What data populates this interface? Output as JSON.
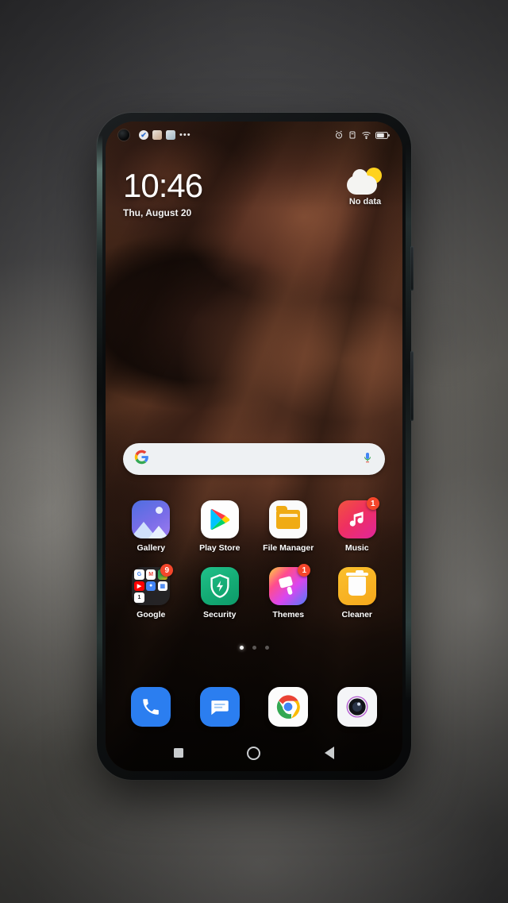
{
  "device": {
    "type": "smartphone",
    "orientation": "portrait",
    "screen_state": "home-screen"
  },
  "backdrop": {
    "description": "blurred gray studio background",
    "colors": {
      "dark": "#3b3b3e",
      "mid": "#6e6d6a",
      "light": "#8c8a85"
    }
  },
  "wallpaper": {
    "description": "aerial mars-like rocky terrain",
    "colors": {
      "rust": "#8a5337",
      "brown": "#53301f",
      "dark": "#0a0605"
    }
  },
  "status_bar": {
    "left_icons": [
      {
        "name": "punch-hole-camera",
        "glyph": ""
      },
      {
        "name": "notification-check-icon",
        "glyph": "✔"
      },
      {
        "name": "notification-app-icon-1",
        "glyph": ""
      },
      {
        "name": "notification-app-icon-2",
        "glyph": ""
      },
      {
        "name": "notification-overflow-icon",
        "glyph": "•••"
      }
    ],
    "right_icons": [
      {
        "name": "alarm-icon",
        "glyph": "⏰"
      },
      {
        "name": "vibrate-icon",
        "glyph": "▣"
      },
      {
        "name": "wifi-icon",
        "glyph": "▲"
      },
      {
        "name": "battery-icon",
        "glyph": "▭"
      }
    ]
  },
  "clock_widget": {
    "time": "10:46",
    "date": "Thu, August 20"
  },
  "weather_widget": {
    "icon": "sun-behind-cloud-icon",
    "status": "No data"
  },
  "search_bar": {
    "value": "",
    "placeholder": "",
    "left_icon": "google-g-icon",
    "right_icon": "microphone-icon"
  },
  "app_rows": [
    {
      "row": 1,
      "apps": [
        {
          "label": "Gallery",
          "icon": "gallery-icon",
          "badge": ""
        },
        {
          "label": "Play Store",
          "icon": "play-store-icon",
          "badge": ""
        },
        {
          "label": "File Manager",
          "icon": "file-manager-icon",
          "badge": ""
        },
        {
          "label": "Music",
          "icon": "music-icon",
          "badge": "1"
        }
      ]
    },
    {
      "row": 2,
      "apps": [
        {
          "label": "Google",
          "icon": "google-folder-icon",
          "badge": "9"
        },
        {
          "label": "Security",
          "icon": "security-icon",
          "badge": ""
        },
        {
          "label": "Themes",
          "icon": "themes-icon",
          "badge": "1"
        },
        {
          "label": "Cleaner",
          "icon": "cleaner-icon",
          "badge": ""
        }
      ]
    }
  ],
  "google_folder_contents": [
    {
      "name": "google-search-icon",
      "glyph": "G",
      "color": "#4285f4"
    },
    {
      "name": "gmail-icon",
      "glyph": "M",
      "color": "#ea4335"
    },
    {
      "name": "maps-icon",
      "glyph": "●",
      "color": "#34a853"
    },
    {
      "name": "youtube-icon",
      "glyph": "▶",
      "color": "#ff0000"
    },
    {
      "name": "contacts-icon",
      "glyph": "●",
      "color": "#4285f4"
    },
    {
      "name": "calendar-icon",
      "glyph": "▦",
      "color": "#4285f4"
    },
    {
      "name": "drive-icon",
      "glyph": "1",
      "color": "#202124"
    }
  ],
  "page_indicator": {
    "total": 3,
    "active_index": 0
  },
  "dock": [
    {
      "label": "Phone",
      "icon": "phone-icon"
    },
    {
      "label": "Messages",
      "icon": "messages-icon"
    },
    {
      "label": "Chrome",
      "icon": "chrome-icon"
    },
    {
      "label": "Camera",
      "icon": "camera-icon"
    }
  ],
  "nav_bar": [
    {
      "name": "recents-button",
      "shape": "square"
    },
    {
      "name": "home-button",
      "shape": "circle"
    },
    {
      "name": "back-button",
      "shape": "triangle"
    }
  ]
}
